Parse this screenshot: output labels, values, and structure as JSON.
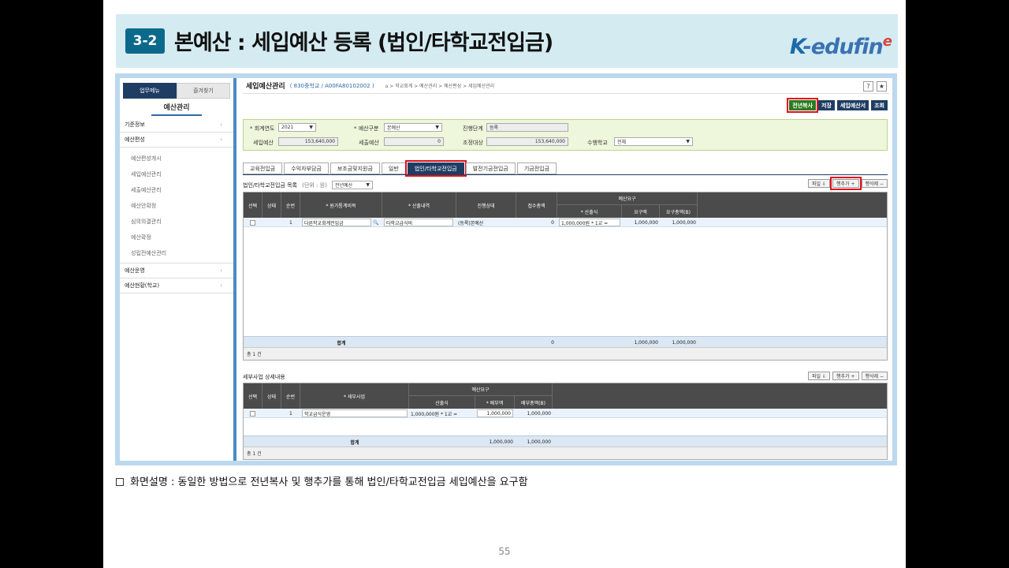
{
  "slide": {
    "badge": "3-2",
    "title": "본예산 : 세입예산 등록 (법인/타학교전입금)",
    "logo": {
      "k": "K",
      "rest": "-edufin",
      "e": "e"
    },
    "description": "화면설명 : 동일한 방법으로 전년복사 및 행추가를 통해 법인/타학교전입금 세입예산을 요구함",
    "page_number": "55"
  },
  "nav": {
    "tab_main": "업무메뉴",
    "tab_fav": "즐겨찾기",
    "header": "예산관리",
    "groups": [
      {
        "label": "기준정보",
        "arrow": "›"
      },
      {
        "label": "예산편성",
        "arrow": "›"
      }
    ],
    "sub_items": [
      "예산편성개시",
      "세입예산관리",
      "세출예산관리",
      "예산안확정",
      "심의의결관리",
      "예산확정",
      "성립전예산관리"
    ],
    "groups_after": [
      {
        "label": "예산운영",
        "arrow": "›"
      },
      {
        "label": "예산현황(학교)",
        "arrow": "›"
      }
    ]
  },
  "topbar": {
    "title": "세입예산관리",
    "school": "( 830중학교 / A00FA80102002 )",
    "breadcrumb": "⌂  > 학교회계 > 예산관리 > 예산편성 > 세입예산관리",
    "help_icon": "?",
    "star_icon": "★"
  },
  "buttons": {
    "copy": "전년복사",
    "save": "저장",
    "report": "세입예산서",
    "search": "조회"
  },
  "filter": {
    "year_label": "* 회계연도",
    "year_value": "2021",
    "type_label": "* 예산구분",
    "type_value": "본예산",
    "stage_label": "진행단계",
    "stage_value": "등록",
    "rev_label": "세입예산",
    "rev_value": "153,640,000",
    "exp_label": "세출예산",
    "exp_value": "0",
    "adj_label": "조정대상",
    "adj_value": "153,640,000",
    "school_label": "수행학교",
    "school_value": "전체",
    "arrow": "▼"
  },
  "subtabs": [
    "교육전입금",
    "수익자부담금",
    "보조금및지원금",
    "일반",
    "법인/타학교전입금",
    "발전기금전입금",
    "기금전입금"
  ],
  "grid1": {
    "title": "법인/타학교전입금 목록",
    "unit": "(단위 : 원)",
    "select": "전년예산",
    "btn_file": "파일 ⇩",
    "btn_add": "행추가 +",
    "btn_del": "행삭제 −",
    "headers": {
      "sel": "선택",
      "state": "상태",
      "no": "순번",
      "account": "* 원가통계비목",
      "detail": "* 산출내역",
      "progress": "진행상태",
      "amount": "접수총액",
      "group": "예산요구",
      "formula": "* 산출식",
      "req": "요구액",
      "total": "요구총액(B)"
    },
    "row": {
      "no": "1",
      "account": "다른학교회계전입금",
      "search": "🔍",
      "detail": "타학교급식비",
      "progress": "(등록)본예산",
      "amount": "0",
      "formula": "1,000,000원 * 1교 =",
      "req": "1,000,000",
      "total": "1,000,000"
    },
    "sum": {
      "label": "합계",
      "amount": "0",
      "req": "1,000,000",
      "total": "1,000,000"
    },
    "count": "총 1 건"
  },
  "grid2": {
    "title": "세부사업 상세내용",
    "btn_file": "파일 ⇩",
    "btn_add": "행추가 +",
    "btn_del": "행삭제 −",
    "headers": {
      "sel": "선택",
      "state": "상태",
      "no": "순번",
      "project": "* 세부사업",
      "group": "예산요구",
      "formula": "산출식",
      "alloc": "* 배부액",
      "total": "배부총액(B)"
    },
    "row": {
      "no": "1",
      "project": "학교급식운영",
      "formula": "1,000,000원 * 1교 =",
      "alloc": "1,000,000",
      "total": "1,000,000"
    },
    "sum": {
      "label": "합계",
      "alloc": "1,000,000",
      "total": "1,000,000"
    },
    "count": "총 1 건"
  }
}
